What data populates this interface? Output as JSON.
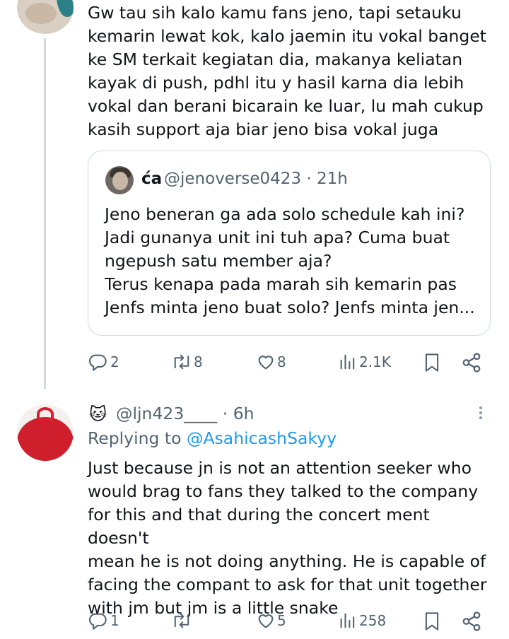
{
  "tweet1": {
    "text": "Gw tau sih kalo kamu fans jeno, tapi setauku\nkemarin lewat kok, kalo jaemin itu vokal banget\nke SM terkait kegiatan dia, makanya keliatan\nkayak di push, pdhl itu y hasil karna dia lebih\nvokal dan berani bicarain ke luar, lu mah cukup\nkasih support aja biar jeno bisa vokal juga",
    "quote": {
      "name": "ća",
      "handle_time": "@jenoverse0423 · 21h",
      "text": "Jeno beneran ga ada solo schedule kah ini?\nJadi gunanya unit ini tuh apa? Cuma buat\nngepush satu member aja?\nTerus kenapa pada marah sih kemarin pas\nJenfs minta jeno buat solo? Jenfs minta jen..."
    },
    "actions": {
      "replies": "2",
      "reposts": "8",
      "likes": "8",
      "views": "2.1K"
    }
  },
  "tweet2": {
    "emoji": "🐱",
    "handle_time": "@ljn423____ · 6h",
    "replying_prefix": "Replying to ",
    "replying_handle": "@AsahicashSakyy",
    "text": "Just because jn is not an attention seeker who\nwould brag to fans they talked to the company\nfor this and that during the concert ment doesn't\nmean he is not doing anything. He is capable of\nfacing the compant to ask for that unit together\nwith jm but jm is a little snake",
    "actions": {
      "replies": "1",
      "reposts": "",
      "likes": "5",
      "views": "258"
    }
  },
  "colors": {
    "text": "#0f1419",
    "muted": "#536471",
    "link": "#1d9bf0",
    "border": "#cfd9de"
  },
  "icons": [
    "reply-icon",
    "repost-icon",
    "like-icon",
    "views-icon",
    "bookmark-icon",
    "share-icon",
    "more-icon"
  ]
}
